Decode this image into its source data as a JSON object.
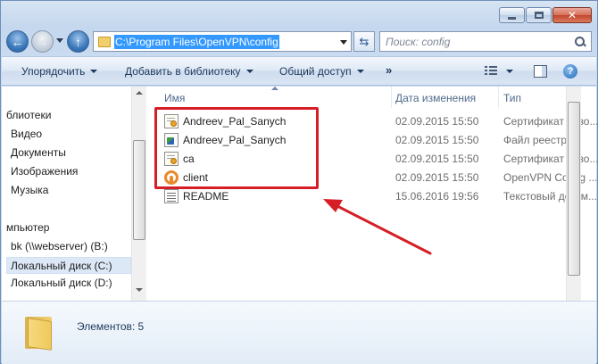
{
  "window": {
    "address_path": "C:\\Program Files\\OpenVPN\\config",
    "search_placeholder": "Поиск: config"
  },
  "toolbar": {
    "organize": "Упорядочить",
    "add_to_library": "Добавить в библиотеку",
    "share": "Общий доступ",
    "more": "»"
  },
  "nav_pane": {
    "libraries_header": "блиотеки",
    "libraries": [
      "Видео",
      "Документы",
      "Изображения",
      "Музыка"
    ],
    "computer_header": "мпьютер",
    "drives": [
      "bk (\\\\webserver) (B:)",
      "Локальный диск (C:)",
      "Локальный диск (D:)"
    ],
    "selected": "Локальный диск (C:)"
  },
  "columns": {
    "name": "Имя",
    "date": "Дата изменения",
    "type": "Тип"
  },
  "files": [
    {
      "name": "Andreev_Pal_Sanych",
      "date": "02.09.2015 15:50",
      "type": "Сертификат безо...",
      "icon": "certificate-icon"
    },
    {
      "name": "Andreev_Pal_Sanych",
      "date": "02.09.2015 15:50",
      "type": "Файл реестра",
      "icon": "registry-icon"
    },
    {
      "name": "ca",
      "date": "02.09.2015 15:50",
      "type": "Сертификат безо...",
      "icon": "certificate-icon"
    },
    {
      "name": "client",
      "date": "02.09.2015 15:50",
      "type": "OpenVPN Config ...",
      "icon": "openvpn-icon"
    },
    {
      "name": "README",
      "date": "15.06.2016 19:56",
      "type": "Текстовый докум...",
      "icon": "text-file-icon"
    }
  ],
  "details": {
    "item_count": "Элементов: 5"
  },
  "colors": {
    "highlight": "#d61e26",
    "address_selection": "#3399ff"
  }
}
